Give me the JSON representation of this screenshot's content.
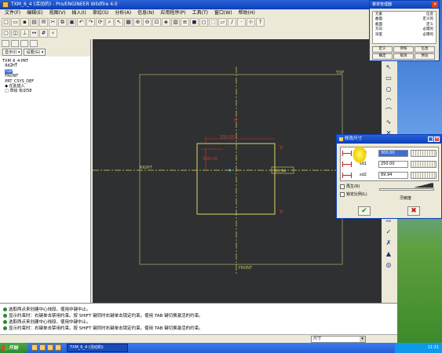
{
  "window": {
    "title": "TXM_6_4 (活动的) - Pro/ENGINEER Wildfire 4.0"
  },
  "menubar": [
    "文件(F)",
    "编辑(E)",
    "视图(V)",
    "插入(I)",
    "草绘(S)",
    "分析(A)",
    "信息(N)",
    "应用程序(P)",
    "工具(T)",
    "窗口(W)",
    "帮助(H)"
  ],
  "left_panel": {
    "dropdown_show": "显示(I) ▾",
    "dropdown_settings": "设置(G) ▾",
    "tree": [
      {
        "label": "TXM_6_4.PRT",
        "selected": false
      },
      {
        "label": "RIGHT",
        "selected": false
      },
      {
        "label": "TOP",
        "selected": true
      },
      {
        "label": "FRONT",
        "selected": false
      },
      {
        "label": "PRT_CSYS_DEF",
        "selected": false
      },
      {
        "label": "◆ 在此插入",
        "selected": false
      },
      {
        "label": "□ 草绘 标识58",
        "selected": false
      }
    ]
  },
  "canvas": {
    "label_top": "TOP",
    "label_right": "RIGHT",
    "label_front": "FRONT",
    "dim_top": "300.00",
    "dim_left": "250.00",
    "dim_box": "89.94"
  },
  "messages": [
    "选取两点来创建中心线段。使用中键中止。",
    "显示约束时：右键单击禁用约束。按 SHIFT 键同时右键单击锁定约束。使用 TAB 键切换激活的约束。",
    "选取两点来创建中心线段。使用中键中止。",
    "显示约束时：右键单击禁用约束。按 SHIFT 键同时右键单击锁定约束。使用 TAB 键切换激活的约束。"
  ],
  "status": {
    "filter": "尺寸"
  },
  "menu_manager": {
    "title": "菜单管理器",
    "rows": [
      [
        "元素",
        "信息"
      ],
      [
        "曲面",
        "定义的"
      ],
      [
        "截面",
        "定义"
      ],
      [
        "方向",
        "必需的"
      ],
      [
        "深度",
        "必需的"
      ]
    ],
    "buttons": [
      "定义",
      "参照",
      "信息",
      "确定",
      "取消",
      "预览"
    ]
  },
  "dialog": {
    "title": "修改尺寸",
    "rows": [
      {
        "name": "sd0",
        "value": "300.00",
        "selected": true
      },
      {
        "name": "sd1",
        "value": "250.00",
        "selected": false
      },
      {
        "name": "sd2",
        "value": "89.94",
        "selected": false
      }
    ],
    "regenerate": "再生(R)",
    "lock_scale": "锁定比例(L)",
    "sensitivity": "灵敏度",
    "ok_symbol": "✔",
    "cancel_symbol": "✖"
  },
  "taskbar": {
    "start": "开始",
    "task": "TXM_6_4 (活动的)",
    "clock": "11:21"
  },
  "colors": {
    "canvas": "#2f3032",
    "sketch": "#d8d860",
    "centerline": "#d8d860",
    "dimension": "#e83030"
  }
}
